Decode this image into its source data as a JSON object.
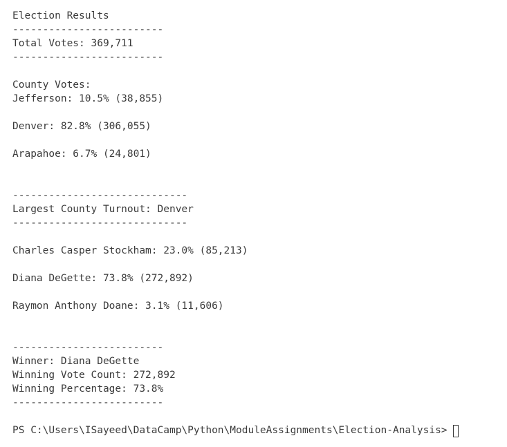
{
  "output": {
    "title": "Election Results",
    "sep_short": "-------------------------",
    "sep_long": "-----------------------------",
    "total_votes": "Total Votes: 369,711",
    "county_header": "County Votes:",
    "counties": [
      "Jefferson: 10.5% (38,855)",
      "Denver: 82.8% (306,055)",
      "Arapahoe: 6.7% (24,801)"
    ],
    "largest_county": "Largest County Turnout: Denver",
    "candidates": [
      "Charles Casper Stockham: 23.0% (85,213)",
      "Diana DeGette: 73.8% (272,892)",
      "Raymon Anthony Doane: 3.1% (11,606)"
    ],
    "winner": "Winner: Diana DeGette",
    "winning_vote_count": "Winning Vote Count: 272,892",
    "winning_percentage": "Winning Percentage: 73.8%"
  },
  "prompt": {
    "text": "PS C:\\Users\\ISayeed\\DataCamp\\Python\\ModuleAssignments\\Election-Analysis>"
  }
}
